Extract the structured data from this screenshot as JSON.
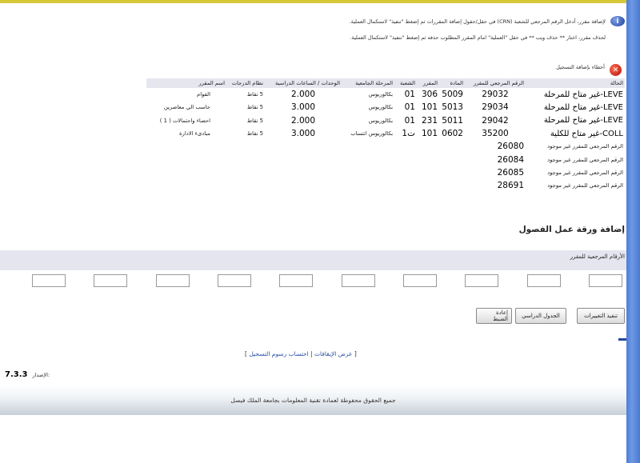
{
  "instructions": {
    "add": "لإضافة مقرر، أدخل الرقم المرجعي للشعبة (CRN) في حقل/حقول إضافة المقررات ثم إضغط \"تنفيذ\" لاستكمال العملية.",
    "drop": "لحذف مقرر، اختار ** حذف ويب ** في حقل \"العملية\" امام المقرر المطلوب حذفه ثم إضغط \"تنفيذ\" لاستكمال العملية."
  },
  "errors_title": "أخطاء بإضافة التسجيل",
  "table": {
    "headers": [
      "الحالة",
      "الرقم المرجعي للمقرر",
      "المادة",
      "المقرر",
      "الشعبة",
      "المرحلة الجامعية",
      "الوحدات / الساعات الدراسية",
      "نظام الدرجات",
      "اسم المقرر"
    ],
    "rows": [
      {
        "status": "LEVE-غير متاح للمرحلة",
        "crn": "29032",
        "subject": "5009",
        "course": "306",
        "section": "01",
        "level": "بكالوريوس",
        "units": "2.000",
        "grade_mode": "5 نقاط",
        "title": "القوام"
      },
      {
        "status": "LEVE-غير متاح للمرحلة",
        "crn": "29034",
        "subject": "5013",
        "course": "101",
        "section": "01",
        "level": "بكالوريوس",
        "units": "3.000",
        "grade_mode": "5 نقاط",
        "title": "حاسب الي معاصرين"
      },
      {
        "status": "LEVE-غير متاح للمرحلة",
        "crn": "29042",
        "subject": "5011",
        "course": "231",
        "section": "01",
        "level": "بكالوريوس",
        "units": "2.000",
        "grade_mode": "5 نقاط",
        "title": "احصاء واحتمالات ( 1 )"
      },
      {
        "status": "COLL-غير متاح للكلية",
        "crn": "35200",
        "subject": "0602",
        "course": "101",
        "section": "ت1",
        "level": "بكالوريوس انتساب",
        "units": "3.000",
        "grade_mode": "5 نقاط",
        "title": "مبادىء الادارة"
      }
    ],
    "missing": [
      {
        "text": "الرقم المرجعي للمقرر غير موجود",
        "crn": "26080"
      },
      {
        "text": "الرقم المرجعي للمقرر غير موجود",
        "crn": "26084"
      },
      {
        "text": "الرقم المرجعي للمقرر غير موجود",
        "crn": "26085"
      },
      {
        "text": "الرقم المرجعي للمقرر غير موجود",
        "crn": "28691"
      }
    ]
  },
  "worksheet": {
    "title": "إضافة ورقة عمل الفصول",
    "crn_label": "الأرقام المرجعية للمقرر",
    "inputs": [
      "",
      "",
      "",
      "",
      "",
      "",
      "",
      "",
      "",
      ""
    ]
  },
  "buttons": {
    "submit": "تنفيذ التغييرات",
    "schedule": "الجدول الدراسي",
    "reset": "إعادة الضبط"
  },
  "links": {
    "holds": "عرض الإيقافات",
    "fees": "احتساب رسوم التسجيل"
  },
  "version": {
    "label": "الإصدار:",
    "value": "7.3.3"
  },
  "footer": "جميع الحقوق محفوظة لعمادة تقنية المعلومات بجامعة الملك فيصل",
  "colors": {
    "accent_bar": "#d7c83a",
    "rail": "#4d7ed8",
    "band": "#e5e5ef",
    "link": "#2a4ca5"
  }
}
